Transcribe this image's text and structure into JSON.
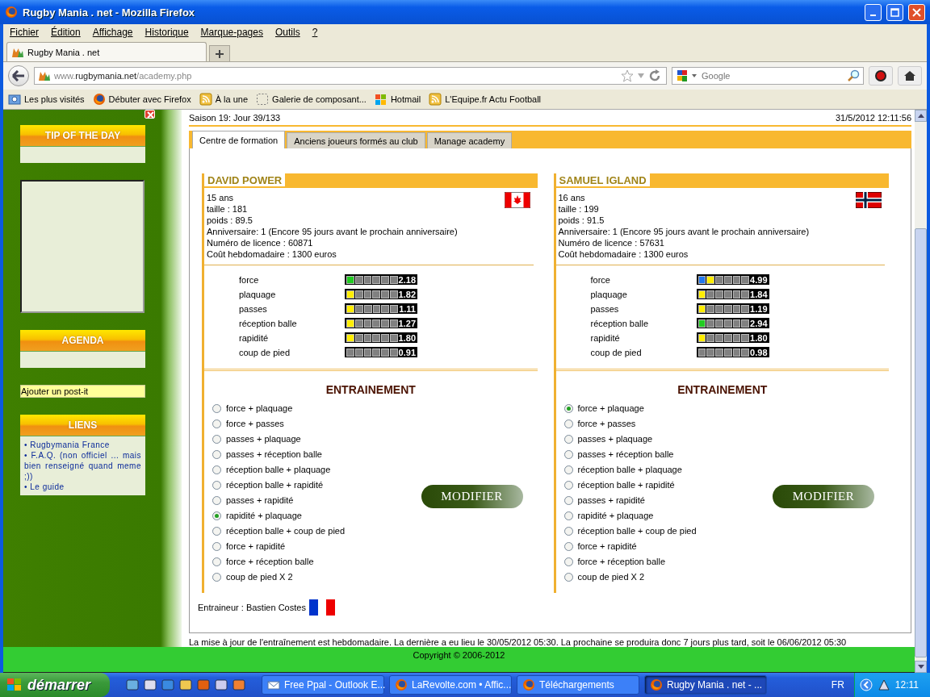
{
  "window": {
    "title": "Rugby Mania . net - Mozilla Firefox"
  },
  "menu": [
    "Fichier",
    "Édition",
    "Affichage",
    "Historique",
    "Marque-pages",
    "Outils",
    "?"
  ],
  "tabs": [
    {
      "label": "Rugby Mania . net",
      "selected": true
    }
  ],
  "address": {
    "parts": [
      "www.",
      "rugbymania.net",
      "/academy.php"
    ]
  },
  "search": {
    "placeholder": "Google"
  },
  "bookmarks": [
    {
      "label": "Les plus visités",
      "kind": "folder"
    },
    {
      "label": "Débuter avec Firefox",
      "kind": "firefox"
    },
    {
      "label": "À la une",
      "kind": "feed"
    },
    {
      "label": "Galerie de composant...",
      "kind": "blank"
    },
    {
      "label": "Hotmail",
      "kind": "windows"
    },
    {
      "label": "L'Equipe.fr Actu Football",
      "kind": "feed"
    }
  ],
  "sidebar": {
    "tip_title": "TIP OF THE DAY",
    "agenda_title": "AGENDA",
    "postit": "Ajouter un post-it",
    "links_title": "LIENS",
    "links": [
      "• Rugbymania France",
      "• F.A.Q. (non officiel ... mais bien renseigné quand meme ;))",
      "• Le guide"
    ]
  },
  "page": {
    "season": "Saison 19: Jour 39/133",
    "datetime": "31/5/2012 12:11:56",
    "tabs": [
      {
        "label": "Centre de formation",
        "selected": true
      },
      {
        "label": "Anciens joueurs formés au club",
        "selected": false
      },
      {
        "label": "Manage academy",
        "selected": false
      }
    ],
    "players": [
      {
        "name": "DAVID POWER",
        "flag": {
          "kind": "canada"
        },
        "info": [
          "15 ans",
          "taille : 181",
          "poids : 89.5",
          "Anniversaire: 1 (Encore 95 jours avant le prochain anniversaire)",
          "Numéro de licence : 60871",
          "Coût hebdomadaire : 1300 euros"
        ],
        "skills": [
          {
            "name": "force",
            "value": "2.18",
            "colored": [
              {
                "color": "#22cc22"
              }
            ]
          },
          {
            "name": "plaquage",
            "value": "1.82",
            "colored": [
              {
                "color": "#ffee00"
              }
            ]
          },
          {
            "name": "passes",
            "value": "1.11",
            "colored": [
              {
                "color": "#ffee00"
              }
            ]
          },
          {
            "name": "réception balle",
            "value": "1.27",
            "colored": [
              {
                "color": "#ffee00"
              }
            ]
          },
          {
            "name": "rapidité",
            "value": "1.80",
            "colored": [
              {
                "color": "#ffee00"
              }
            ]
          },
          {
            "name": "coup de pied",
            "value": "0.91"
          }
        ],
        "training_title": "ENTRAINEMENT",
        "options": [
          {
            "label": "force + plaquage",
            "selected": false
          },
          {
            "label": "force + passes",
            "selected": false
          },
          {
            "label": "passes + plaquage",
            "selected": false
          },
          {
            "label": "passes + réception balle",
            "selected": false
          },
          {
            "label": "réception balle + plaquage",
            "selected": false
          },
          {
            "label": "réception balle + rapidité",
            "selected": false
          },
          {
            "label": "passes + rapidité",
            "selected": false
          },
          {
            "label": "rapidité + plaquage",
            "selected": true
          },
          {
            "label": "réception balle + coup de pied",
            "selected": false
          },
          {
            "label": "force + rapidité",
            "selected": false
          },
          {
            "label": "force + réception balle",
            "selected": false
          },
          {
            "label": "coup de pied X 2",
            "selected": false
          }
        ],
        "button": "MODIFIER"
      },
      {
        "name": "SAMUEL IGLAND",
        "flag": {
          "kind": "norway"
        },
        "info": [
          "16 ans",
          "taille : 199",
          "poids : 91.5",
          "Anniversaire: 1 (Encore 95 jours avant le prochain anniversaire)",
          "Numéro de licence : 57631",
          "Coût hebdomadaire : 1300 euros"
        ],
        "skills": [
          {
            "name": "force",
            "value": "4.99",
            "colored": [
              {
                "color": "#2277ee"
              },
              {
                "color": "#ffee00"
              }
            ]
          },
          {
            "name": "plaquage",
            "value": "1.84",
            "colored": [
              {
                "color": "#ffee00"
              }
            ]
          },
          {
            "name": "passes",
            "value": "1.19",
            "colored": [
              {
                "color": "#ffee00"
              }
            ]
          },
          {
            "name": "réception balle",
            "value": "2.94",
            "colored": [
              {
                "color": "#22cc22"
              }
            ]
          },
          {
            "name": "rapidité",
            "value": "1.80",
            "colored": [
              {
                "color": "#ffee00"
              }
            ]
          },
          {
            "name": "coup de pied",
            "value": "0.98"
          }
        ],
        "training_title": "ENTRAINEMENT",
        "options": [
          {
            "label": "force + plaquage",
            "selected": true
          },
          {
            "label": "force + passes",
            "selected": false
          },
          {
            "label": "passes + plaquage",
            "selected": false
          },
          {
            "label": "passes + réception balle",
            "selected": false
          },
          {
            "label": "réception balle + plaquage",
            "selected": false
          },
          {
            "label": "réception balle + rapidité",
            "selected": false
          },
          {
            "label": "passes + rapidité",
            "selected": false
          },
          {
            "label": "rapidité + plaquage",
            "selected": false
          },
          {
            "label": "réception balle + coup de pied",
            "selected": false
          },
          {
            "label": "force + rapidité",
            "selected": false
          },
          {
            "label": "force + réception balle",
            "selected": false
          },
          {
            "label": "coup de pied X 2",
            "selected": false
          }
        ],
        "button": "MODIFIER"
      }
    ],
    "coach": {
      "label": "Entraineur : Bastien Costes",
      "flag": {
        "kind": "france"
      }
    },
    "note": "La mise à jour de l'entraînement est hebdomadaire. La dernière a eu lieu le 30/05/2012 05:30. La prochaine se produira donc 7 jours plus tard, soit le 06/06/2012 05:30",
    "copyright": "Copyright © 2006-2012"
  },
  "taskbar": {
    "start": "démarrer",
    "tasks": [
      {
        "label": "Free Ppal - Outlook E...",
        "kind": "mail",
        "selected": false
      },
      {
        "label": "LaRevolte.com • Affic...",
        "kind": "firefox",
        "selected": false
      },
      {
        "label": "Téléchargements",
        "kind": "firefox",
        "selected": false
      },
      {
        "label": "Rugby Mania . net - ...",
        "kind": "firefox",
        "selected": true
      }
    ],
    "lang": "FR",
    "clock": "12:11"
  }
}
